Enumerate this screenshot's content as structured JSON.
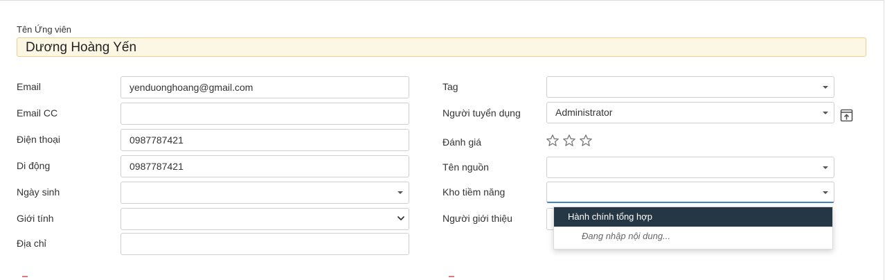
{
  "header": {
    "name_label": "Tên Ứng viên",
    "name_value": "Dương Hoàng Yến"
  },
  "left": {
    "email_label": "Email",
    "email_value": "yenduonghoang@gmail.com",
    "email_cc_label": "Email CC",
    "email_cc_value": "",
    "phone_label": "Điện thoại",
    "phone_value": "0987787421",
    "mobile_label": "Di động",
    "mobile_value": "0987787421",
    "birthday_label": "Ngày sinh",
    "birthday_value": "",
    "gender_label": "Giới tính",
    "gender_value": "",
    "address_label": "Địa chỉ",
    "address_value": ""
  },
  "right": {
    "tag_label": "Tag",
    "tag_value": "",
    "recruiter_label": "Người tuyển dụng",
    "recruiter_value": "Administrator",
    "rating_label": "Đánh giá",
    "rating_value": 0,
    "rating_max": 3,
    "source_label": "Tên nguồn",
    "source_value": "",
    "pool_label": "Kho tiềm năng",
    "pool_value": "",
    "referrer_label": "Người giới thiệu"
  },
  "dropdown": {
    "active_item": "Hành chính tổng hợp",
    "hint": "Đang nhập nội dung..."
  },
  "icons": {
    "caret": "caret-down-icon",
    "chevron": "chevron-down-icon",
    "star": "star-outline-icon",
    "external": "external-link-icon"
  },
  "colors": {
    "name_bg": "#fcf6e4",
    "name_border": "#e9cf8f",
    "dropdown_active_bg": "#253745",
    "focus_border": "#3a86c6"
  }
}
